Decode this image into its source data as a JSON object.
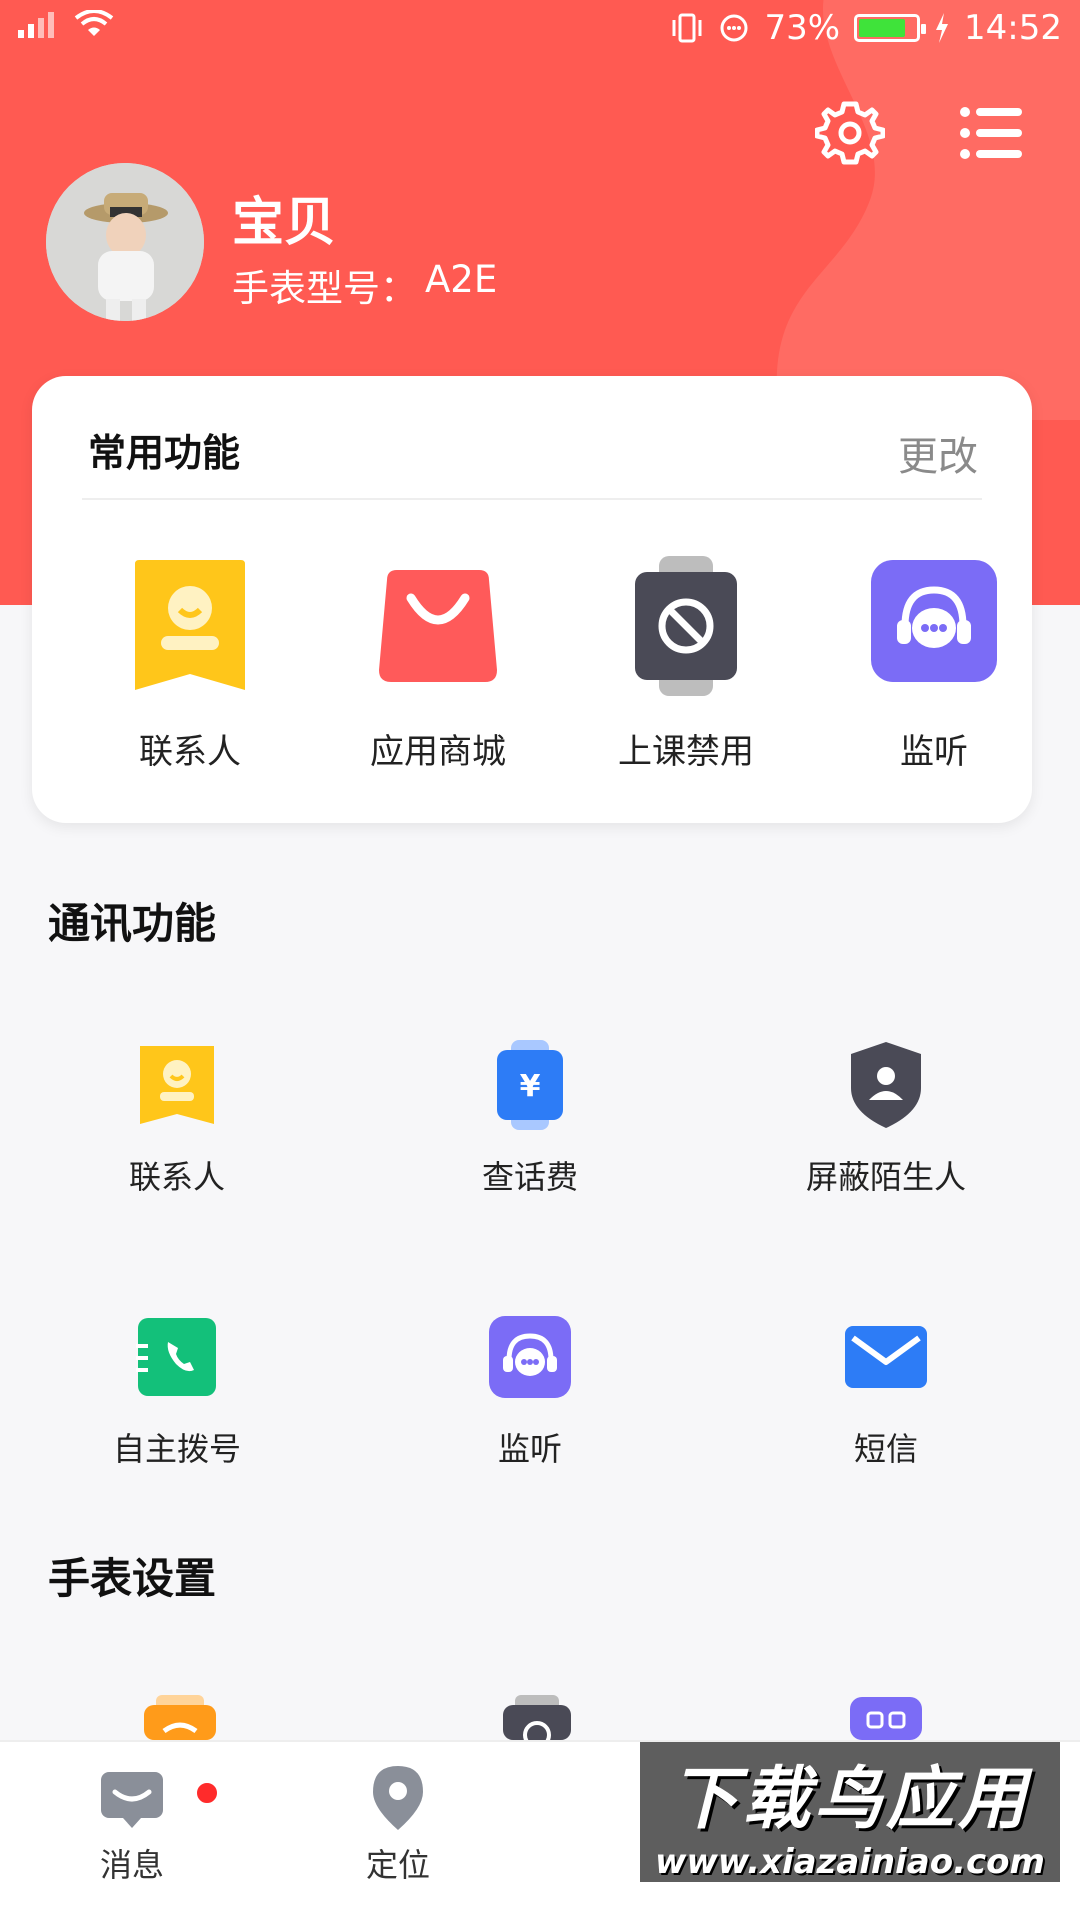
{
  "status_bar": {
    "battery": "73%",
    "time": "14:52"
  },
  "header": {
    "settings_icon": "gear-icon",
    "menu_icon": "list-menu-icon"
  },
  "profile": {
    "name": "宝贝",
    "model_label": "手表型号：",
    "model_value": "A2E"
  },
  "common": {
    "title": "常用功能",
    "edit": "更改",
    "items": [
      {
        "label": "联系人",
        "icon": "contact-card-icon"
      },
      {
        "label": "应用商城",
        "icon": "shopping-bag-icon"
      },
      {
        "label": "上课禁用",
        "icon": "watch-ban-icon"
      },
      {
        "label": "监听",
        "icon": "robot-headset-icon"
      }
    ]
  },
  "comm": {
    "title": "通讯功能",
    "items": [
      {
        "label": "联系人",
        "icon": "contact-card-icon"
      },
      {
        "label": "查话费",
        "icon": "watch-yuan-icon"
      },
      {
        "label": "屏蔽陌生人",
        "icon": "shield-person-icon"
      },
      {
        "label": "自主拨号",
        "icon": "phone-dial-icon"
      },
      {
        "label": "监听",
        "icon": "robot-headset-icon"
      },
      {
        "label": "短信",
        "icon": "envelope-icon"
      }
    ]
  },
  "watch": {
    "title": "手表设置"
  },
  "nav": {
    "items": [
      {
        "label": "消息",
        "icon": "chat-bubble-icon"
      },
      {
        "label": "定位",
        "icon": "location-pin-icon"
      }
    ]
  },
  "watermark": {
    "line1": "下载鸟应用",
    "line2": "www.xiazainiao.com"
  },
  "colors": {
    "header_red": "#ff5a52",
    "accent_purple": "#7b6cf6",
    "accent_yellow": "#ffc61a",
    "accent_green": "#13c07a",
    "accent_blue": "#2d7cf6"
  }
}
